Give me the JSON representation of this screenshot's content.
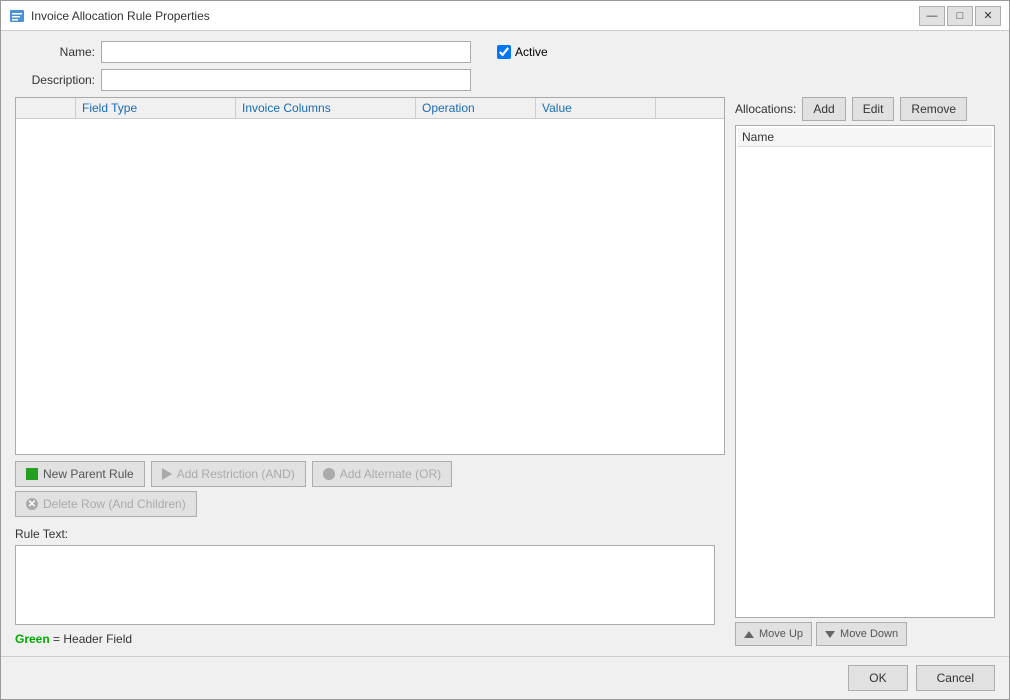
{
  "window": {
    "title": "Invoice Allocation Rule Properties",
    "icon": "invoice-icon"
  },
  "title_controls": {
    "minimize": "—",
    "maximize": "□",
    "close": "✕"
  },
  "form": {
    "name_label": "Name:",
    "name_value": "",
    "name_placeholder": "",
    "description_label": "Description:",
    "description_value": "",
    "description_placeholder": "",
    "active_label": "Active",
    "active_checked": true
  },
  "grid": {
    "columns": [
      {
        "label": "",
        "key": "icon"
      },
      {
        "label": "Field Type",
        "key": "field_type"
      },
      {
        "label": "Invoice Columns",
        "key": "invoice_columns"
      },
      {
        "label": "Operation",
        "key": "operation"
      },
      {
        "label": "Value",
        "key": "value"
      }
    ],
    "rows": []
  },
  "allocations": {
    "label": "Allocations:",
    "add_label": "Add",
    "edit_label": "Edit",
    "remove_label": "Remove",
    "column_header": "Name",
    "items": [],
    "move_up_label": "Move Up",
    "move_down_label": "Move Down"
  },
  "actions": {
    "new_parent_rule_label": "New Parent Rule",
    "add_restriction_label": "Add Restriction (AND)",
    "add_alternate_label": "Add Alternate (OR)",
    "delete_row_label": "Delete Row (And Children)"
  },
  "rule_text": {
    "label": "Rule Text:",
    "value": "",
    "placeholder": ""
  },
  "legend": {
    "text": "Green  =  Header Field"
  },
  "footer": {
    "ok_label": "OK",
    "cancel_label": "Cancel"
  }
}
